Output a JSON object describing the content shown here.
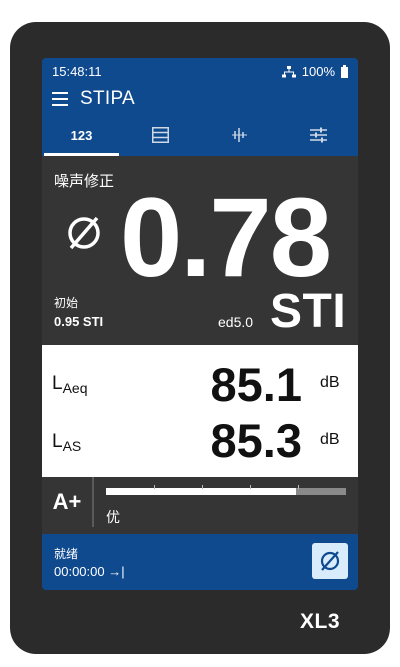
{
  "status_bar": {
    "time": "15:48:11",
    "battery_pct": "100%",
    "network_icon": "network-icon",
    "battery_icon": "battery-icon"
  },
  "title_bar": {
    "title": "STIPA",
    "menu_icon": "hamburger-menu-icon"
  },
  "tabs": [
    {
      "label": "123",
      "icon": "",
      "active": true
    },
    {
      "label": "",
      "icon": "table-view-icon",
      "active": false
    },
    {
      "label": "",
      "icon": "spectrum-icon",
      "active": false
    },
    {
      "label": "",
      "icon": "settings-sliders-icon",
      "active": false
    }
  ],
  "result": {
    "subtitle": "噪声修正",
    "value": "0.78",
    "unit": "STI",
    "initial_label": "初始",
    "initial_value": "0.95 STI",
    "edition": "ed5.0",
    "null_icon": "null-icon"
  },
  "measurements": [
    {
      "name": "L",
      "sub": "Aeq",
      "value": "85.1",
      "unit": "dB"
    },
    {
      "name": "L",
      "sub": "AS",
      "value": "85.3",
      "unit": "dB"
    }
  ],
  "quality": {
    "grade": "A+",
    "label": "优",
    "level_fraction": 0.79
  },
  "footer": {
    "state": "就绪",
    "timer": "00:00:00 →|",
    "button_icon": "null-icon"
  },
  "brand": "XL3",
  "colors": {
    "accent_blue": "#0f4a8f",
    "panel_dark": "#353536",
    "device_body": "#2b2b2c",
    "button_light": "#d9ecfb"
  }
}
